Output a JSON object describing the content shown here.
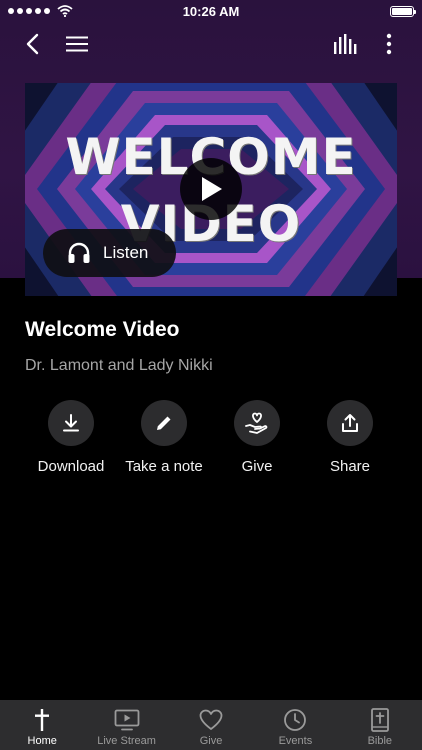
{
  "status_bar": {
    "time": "10:26 AM"
  },
  "nav": {
    "back_icon": "chevron-left-icon",
    "menu_icon": "hamburger-icon",
    "audio_icon": "equalizer-icon",
    "more_icon": "more-vertical-icon"
  },
  "video": {
    "overlay_line1": "WELCOME",
    "overlay_line2": "VIDEO",
    "listen_label": "Listen"
  },
  "content": {
    "title": "Welcome Video",
    "subtitle": "Dr. Lamont and Lady Nikki"
  },
  "actions": [
    {
      "label": "Download",
      "icon": "download-icon"
    },
    {
      "label": "Take a note",
      "icon": "pencil-icon"
    },
    {
      "label": "Give",
      "icon": "give-heart-hand-icon"
    },
    {
      "label": "Share",
      "icon": "share-icon"
    }
  ],
  "tabs": [
    {
      "label": "Home",
      "icon": "cross-icon",
      "active": true
    },
    {
      "label": "Live Stream",
      "icon": "tv-play-icon",
      "active": false
    },
    {
      "label": "Give",
      "icon": "heart-icon",
      "active": false
    },
    {
      "label": "Events",
      "icon": "clock-icon",
      "active": false
    },
    {
      "label": "Bible",
      "icon": "bible-icon",
      "active": false
    }
  ],
  "colors": {
    "header_purple": "#2a123d",
    "background": "#000000",
    "tabbar": "#2d2d2f",
    "action_circle": "#2c2c2e",
    "subtitle": "#a6a6a6"
  }
}
